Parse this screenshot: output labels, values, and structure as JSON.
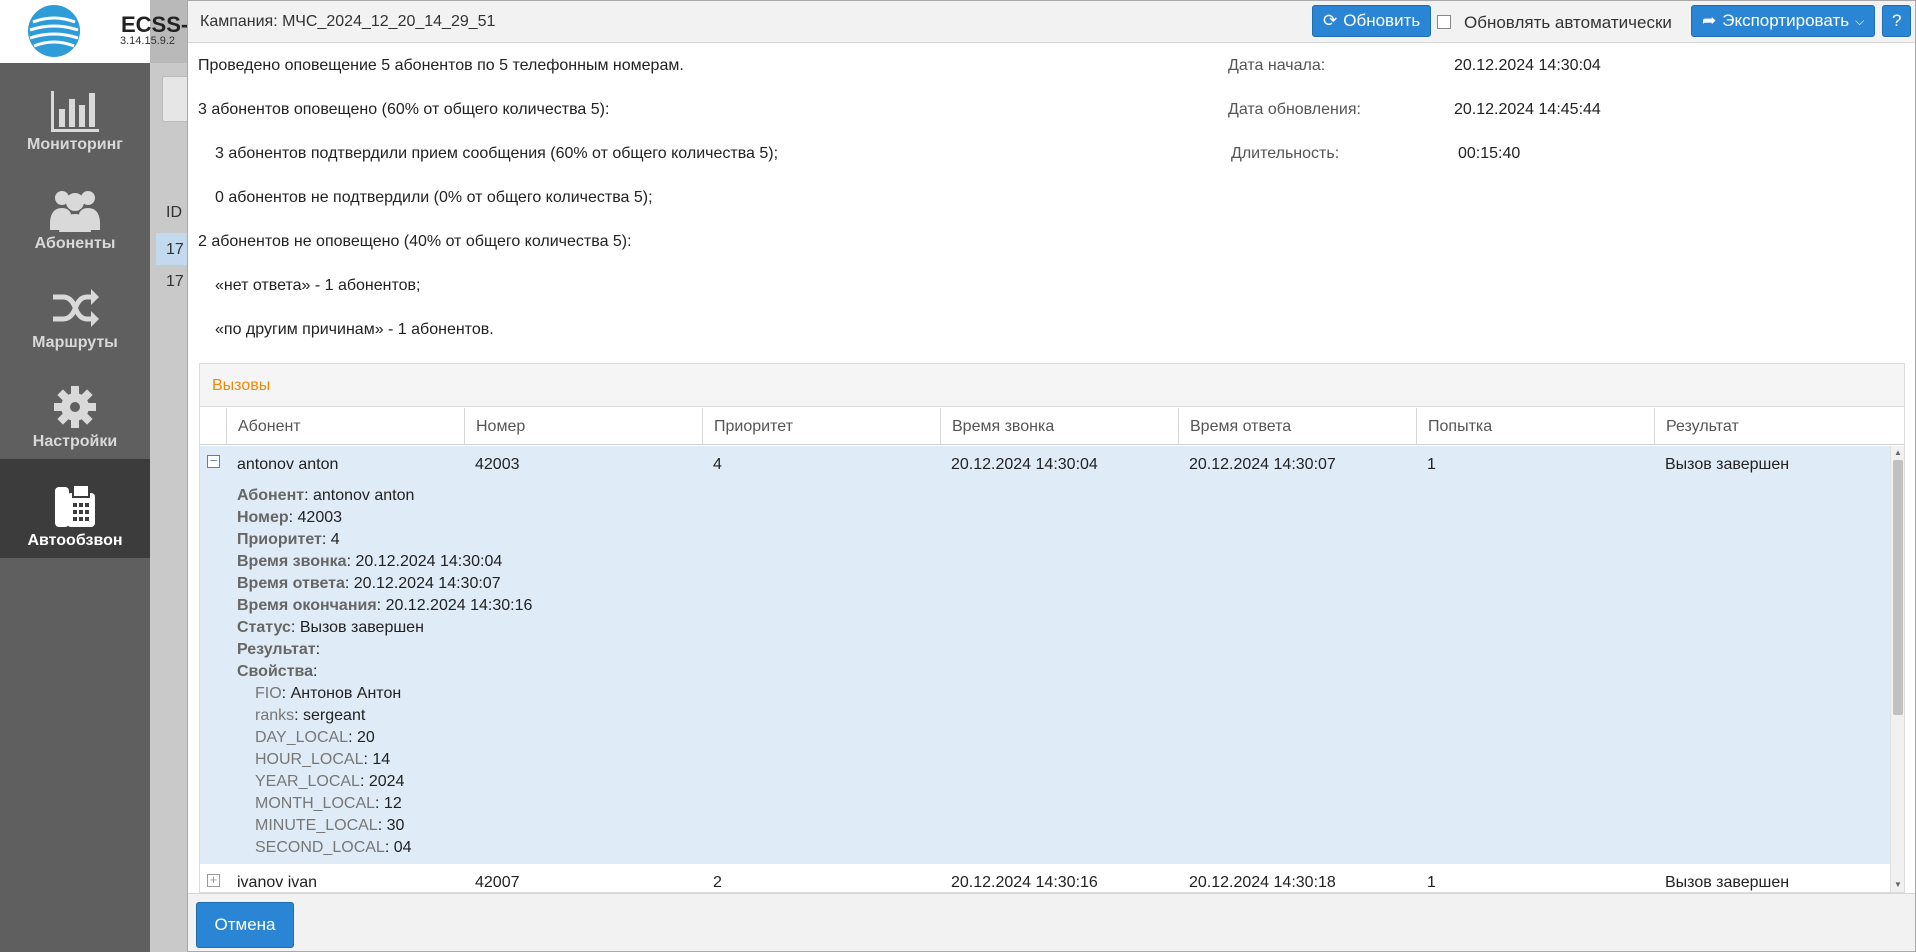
{
  "app": {
    "name": "ECSS-",
    "version": "3.14.15.9.2"
  },
  "sidebar": {
    "items": [
      {
        "label": "Мониторинг",
        "icon": "bar-chart-icon"
      },
      {
        "label": "Абоненты",
        "icon": "users-icon"
      },
      {
        "label": "Маршруты",
        "icon": "shuffle-icon"
      },
      {
        "label": "Настройки",
        "icon": "gear-icon"
      },
      {
        "label": "Автообзвон",
        "icon": "fax-phone-icon",
        "active": true
      }
    ]
  },
  "background": {
    "column_id": "ID",
    "rows": [
      "17",
      "17"
    ]
  },
  "modal": {
    "title": "Кампания: МЧС_2024_12_20_14_29_51",
    "refresh_label": "Обновить",
    "auto_refresh_label": "Обновлять автоматически",
    "auto_refresh_checked": false,
    "export_label": "Экспортировать",
    "help_label": "?",
    "cancel_label": "Отмена"
  },
  "summary": {
    "lines": [
      "Проведено оповещение 5 абонентов по 5 телефонным номерам.",
      "3 абонентов оповещено (60% от общего количества 5):",
      "3 абонентов подтвердили прием сообщения (60% от общего количества 5);",
      "0 абонентов не подтвердили (0% от общего количества 5);",
      "2 абонентов не оповещено (40% от общего количества 5):",
      "«нет ответа» - 1 абонентов;",
      "«по другим причинам» - 1 абонентов."
    ],
    "start_label": "Дата начала:",
    "start_value": "20.12.2024 14:30:04",
    "updated_label": "Дата обновления:",
    "updated_value": "20.12.2024 14:45:44",
    "duration_label": "Длительность:",
    "duration_value": "00:15:40"
  },
  "calls": {
    "title": "Вызовы",
    "columns": [
      "Абонент",
      "Номер",
      "Приоритет",
      "Время звонка",
      "Время ответа",
      "Попытка",
      "Результат"
    ],
    "rows": [
      {
        "subscriber": "antonov anton",
        "number": "42003",
        "priority": "4",
        "call_time": "20.12.2024 14:30:04",
        "answer_time": "20.12.2024 14:30:07",
        "attempt": "1",
        "result": "Вызов завершен",
        "expanded": true,
        "details": {
          "subscriber_label": "Абонент",
          "subscriber": "antonov anton",
          "number_label": "Номер",
          "number": "42003",
          "priority_label": "Приоритет",
          "priority": "4",
          "call_time_label": "Время звонка",
          "call_time": "20.12.2024 14:30:04",
          "answer_time_label": "Время ответа",
          "answer_time": "20.12.2024 14:30:07",
          "end_time_label": "Время окончания",
          "end_time": "20.12.2024 14:30:16",
          "status_label": "Статус",
          "status": "Вызов завершен",
          "result_label": "Результат",
          "result": "",
          "properties_label": "Свойства",
          "properties": [
            {
              "key": "FIO",
              "value": "Антонов Антон"
            },
            {
              "key": "ranks",
              "value": "sergeant"
            },
            {
              "key": "DAY_LOCAL",
              "value": "20"
            },
            {
              "key": "HOUR_LOCAL",
              "value": "14"
            },
            {
              "key": "YEAR_LOCAL",
              "value": "2024"
            },
            {
              "key": "MONTH_LOCAL",
              "value": "12"
            },
            {
              "key": "MINUTE_LOCAL",
              "value": "30"
            },
            {
              "key": "SECOND_LOCAL",
              "value": "04"
            }
          ]
        }
      },
      {
        "subscriber": "ivanov ivan",
        "number": "42007",
        "priority": "2",
        "call_time": "20.12.2024 14:30:16",
        "answer_time": "20.12.2024 14:30:18",
        "attempt": "1",
        "result": "Вызов завершен",
        "expanded": false
      }
    ]
  },
  "colors": {
    "accent": "#2a86d4",
    "section_title": "#f08a00",
    "sidebar_bg": "#5f5f5f",
    "expanded_row_bg": "#dfebf6"
  }
}
